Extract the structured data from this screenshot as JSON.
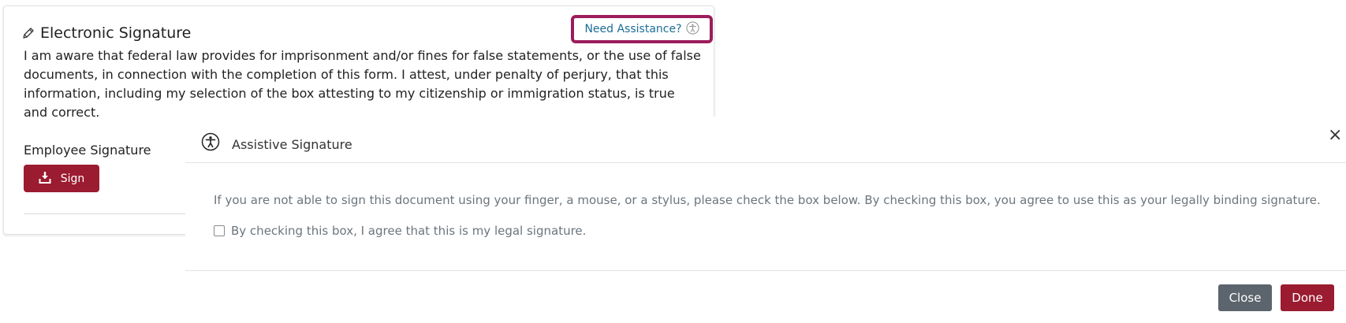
{
  "card": {
    "title": "Electronic Signature",
    "need_assistance": "Need Assistance?",
    "attestation": "I am aware that federal law provides for imprisonment and/or fines for false statements, or the use of false documents, in connection with the completion of this form. I attest, under penalty of perjury, that this information, including my selection of the box attesting to my citizenship or immigration status, is true and correct.",
    "employee_signature_label": "Employee Signature",
    "sign_button": "Sign",
    "icons": {
      "title": "pencil-icon",
      "help": "accessibility-icon",
      "sign": "download-icon"
    }
  },
  "modal": {
    "title": "Assistive Signature",
    "close_symbol": "×",
    "body_text": "If you are not able to sign this document using your finger, a mouse, or a stylus, please check the box below. By checking this box, you agree to use this as your legally binding signature.",
    "checkbox_label": "By checking this box, I agree that this is my legal signature.",
    "checkbox_checked": false,
    "close_button": "Close",
    "done_button": "Done",
    "icons": {
      "header": "accessibility-icon",
      "close": "close-icon"
    }
  },
  "colors": {
    "brand": "#9b1b30",
    "highlight_border": "#9c1c5c",
    "link": "#1a6e96",
    "secondary_button": "#5c656d"
  }
}
